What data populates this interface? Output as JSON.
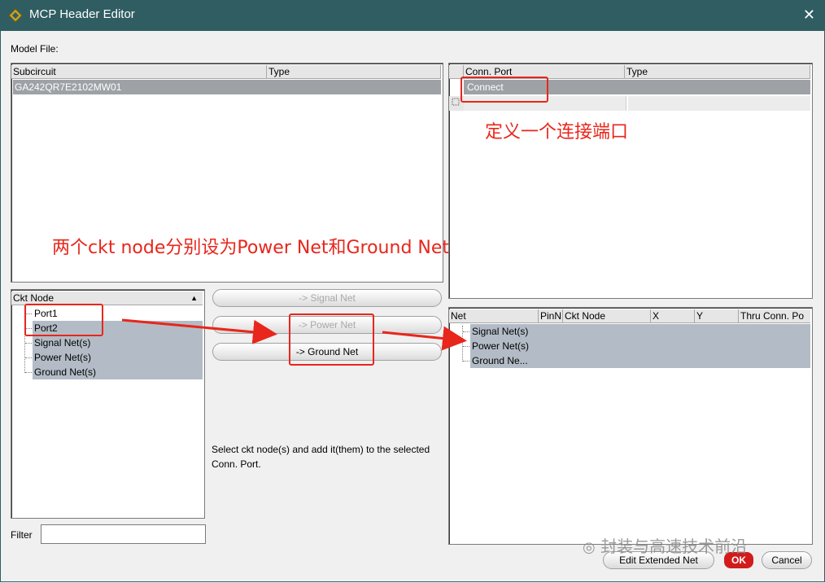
{
  "window": {
    "title": "MCP Header Editor",
    "close_glyph": "✕"
  },
  "model_file_label": "Model File:",
  "subcircuit_table": {
    "columns": [
      "Subcircuit",
      "Type"
    ],
    "rows": [
      {
        "subcircuit": "GA242QR7E2102MW01",
        "type": ""
      }
    ]
  },
  "conn_port_table": {
    "columns": [
      "Conn. Port",
      "Type"
    ],
    "rows": [
      {
        "port": "Connect",
        "type": ""
      }
    ]
  },
  "ckt_node_panel": {
    "header": "Ckt Node",
    "items": [
      "Port1",
      "Port2",
      "Signal Net(s)",
      "Power Net(s)",
      "Ground Net(s)"
    ]
  },
  "buttons": {
    "signal_net": "-> Signal Net",
    "power_net": "-> Power Net",
    "ground_net": "-> Ground Net",
    "edit_extended_net": "Edit Extended Net",
    "ok": "OK",
    "cancel": "Cancel"
  },
  "help_text": "Select ckt node(s)  and add it(them) to the selected Conn. Port.",
  "net_table": {
    "columns": [
      "Net",
      "PinN",
      "Ckt Node",
      "X",
      "Y",
      "Thru Conn. Po"
    ],
    "items": [
      "Signal Net(s)",
      "Power Net(s)",
      "Ground Ne..."
    ]
  },
  "filter": {
    "label": "Filter",
    "value": ""
  },
  "annotations": {
    "define_port": "定义一个连接端口",
    "two_nodes": "两个ckt node分别设为Power Net和Ground Net",
    "color": "#e8261b"
  },
  "watermark": "封装与高速技术前沿"
}
